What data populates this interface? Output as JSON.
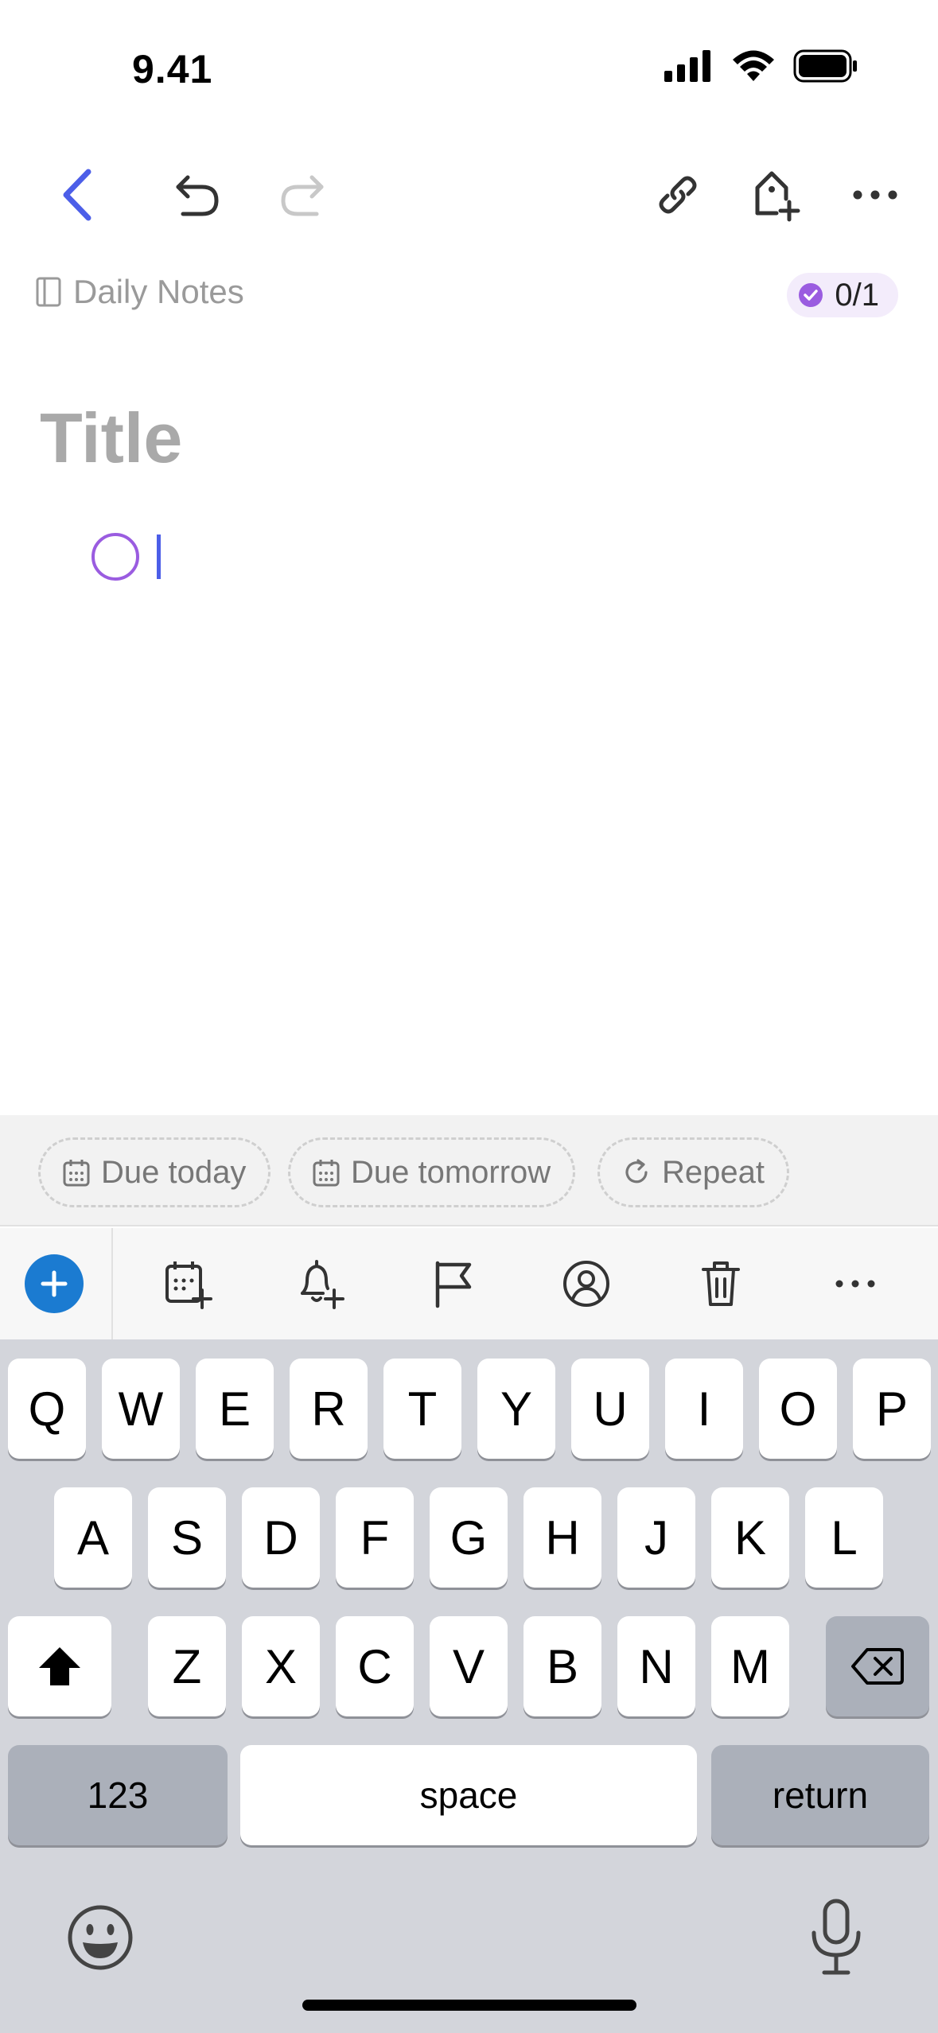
{
  "status_bar": {
    "time": "9.41"
  },
  "nav": {
    "back": "back-icon",
    "undo": "undo-icon",
    "redo": "redo-icon",
    "link": "link-icon",
    "add_tag": "tag-add-icon",
    "more": "more-icon"
  },
  "meta": {
    "notebook_label": "Daily Notes",
    "progress": "0/1"
  },
  "editor": {
    "title_placeholder": "Title"
  },
  "chips": [
    {
      "label": "Due today",
      "icon": "calendar-icon"
    },
    {
      "label": "Due tomorrow",
      "icon": "calendar-icon"
    },
    {
      "label": "Repeat",
      "icon": "repeat-icon"
    }
  ],
  "actions": [
    "add-icon",
    "calendar-add-icon",
    "reminder-add-icon",
    "flag-icon",
    "assignee-icon",
    "trash-icon",
    "more-icon"
  ],
  "keyboard": {
    "row1": [
      "Q",
      "W",
      "E",
      "R",
      "T",
      "Y",
      "U",
      "I",
      "O",
      "P"
    ],
    "row2": [
      "A",
      "S",
      "D",
      "F",
      "G",
      "H",
      "J",
      "K",
      "L"
    ],
    "row3": [
      "Z",
      "X",
      "C",
      "V",
      "B",
      "N",
      "M"
    ],
    "numbers_label": "123",
    "space_label": "space",
    "return_label": "return"
  },
  "colors": {
    "accent_blue": "#4c5ee8",
    "task_purple": "#9a5ce0",
    "add_button": "#1b7bd1"
  }
}
